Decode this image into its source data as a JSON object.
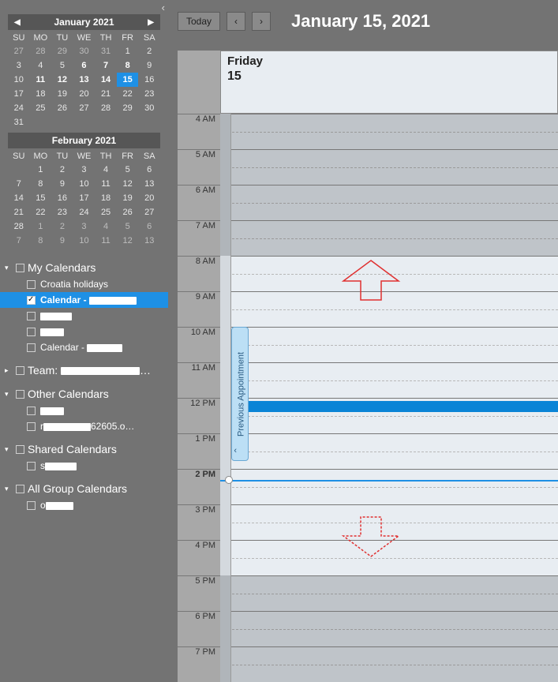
{
  "sidebar": {
    "month1": {
      "title": "January 2021",
      "dows": [
        "SU",
        "MO",
        "TU",
        "WE",
        "TH",
        "FR",
        "SA"
      ],
      "days": [
        {
          "n": "27",
          "in": false
        },
        {
          "n": "28",
          "in": false
        },
        {
          "n": "29",
          "in": false
        },
        {
          "n": "30",
          "in": false
        },
        {
          "n": "31",
          "in": false
        },
        {
          "n": "1",
          "in": true
        },
        {
          "n": "2",
          "in": true
        },
        {
          "n": "3",
          "in": true
        },
        {
          "n": "4",
          "in": true
        },
        {
          "n": "5",
          "in": true
        },
        {
          "n": "6",
          "in": true,
          "b": true
        },
        {
          "n": "7",
          "in": true,
          "b": true
        },
        {
          "n": "8",
          "in": true,
          "b": true
        },
        {
          "n": "9",
          "in": true
        },
        {
          "n": "10",
          "in": true
        },
        {
          "n": "11",
          "in": true,
          "b": true
        },
        {
          "n": "12",
          "in": true,
          "b": true
        },
        {
          "n": "13",
          "in": true,
          "b": true
        },
        {
          "n": "14",
          "in": true,
          "b": true
        },
        {
          "n": "15",
          "in": true,
          "sel": true
        },
        {
          "n": "16",
          "in": true
        },
        {
          "n": "17",
          "in": true
        },
        {
          "n": "18",
          "in": true
        },
        {
          "n": "19",
          "in": true
        },
        {
          "n": "20",
          "in": true
        },
        {
          "n": "21",
          "in": true
        },
        {
          "n": "22",
          "in": true
        },
        {
          "n": "23",
          "in": true
        },
        {
          "n": "24",
          "in": true
        },
        {
          "n": "25",
          "in": true
        },
        {
          "n": "26",
          "in": true
        },
        {
          "n": "27",
          "in": true
        },
        {
          "n": "28",
          "in": true
        },
        {
          "n": "29",
          "in": true
        },
        {
          "n": "30",
          "in": true
        },
        {
          "n": "31",
          "in": true
        },
        {
          "n": "",
          "in": false
        },
        {
          "n": "",
          "in": false
        },
        {
          "n": "",
          "in": false
        },
        {
          "n": "",
          "in": false
        },
        {
          "n": "",
          "in": false
        },
        {
          "n": "",
          "in": false
        }
      ]
    },
    "month2": {
      "title": "February 2021",
      "dows": [
        "SU",
        "MO",
        "TU",
        "WE",
        "TH",
        "FR",
        "SA"
      ],
      "days": [
        {
          "n": "",
          "in": false
        },
        {
          "n": "1",
          "in": true
        },
        {
          "n": "2",
          "in": true
        },
        {
          "n": "3",
          "in": true
        },
        {
          "n": "4",
          "in": true
        },
        {
          "n": "5",
          "in": true
        },
        {
          "n": "6",
          "in": true
        },
        {
          "n": "7",
          "in": true
        },
        {
          "n": "8",
          "in": true
        },
        {
          "n": "9",
          "in": true
        },
        {
          "n": "10",
          "in": true
        },
        {
          "n": "11",
          "in": true
        },
        {
          "n": "12",
          "in": true
        },
        {
          "n": "13",
          "in": true
        },
        {
          "n": "14",
          "in": true
        },
        {
          "n": "15",
          "in": true
        },
        {
          "n": "16",
          "in": true
        },
        {
          "n": "17",
          "in": true
        },
        {
          "n": "18",
          "in": true
        },
        {
          "n": "19",
          "in": true
        },
        {
          "n": "20",
          "in": true
        },
        {
          "n": "21",
          "in": true
        },
        {
          "n": "22",
          "in": true
        },
        {
          "n": "23",
          "in": true
        },
        {
          "n": "24",
          "in": true
        },
        {
          "n": "25",
          "in": true
        },
        {
          "n": "26",
          "in": true
        },
        {
          "n": "27",
          "in": true
        },
        {
          "n": "28",
          "in": true
        },
        {
          "n": "1",
          "in": false
        },
        {
          "n": "2",
          "in": false
        },
        {
          "n": "3",
          "in": false
        },
        {
          "n": "4",
          "in": false
        },
        {
          "n": "5",
          "in": false
        },
        {
          "n": "6",
          "in": false
        },
        {
          "n": "7",
          "in": false
        },
        {
          "n": "8",
          "in": false
        },
        {
          "n": "9",
          "in": false
        },
        {
          "n": "10",
          "in": false
        },
        {
          "n": "11",
          "in": false
        },
        {
          "n": "12",
          "in": false
        },
        {
          "n": "13",
          "in": false
        }
      ]
    },
    "groups": {
      "my": {
        "label": "My Calendars",
        "items": [
          {
            "label": "Croatia holidays",
            "checked": false
          },
          {
            "label": "Calendar - ",
            "suffix_redact": 60,
            "checked": true,
            "selected": true,
            "bold": true
          },
          {
            "label": "",
            "suffix_redact": 40,
            "checked": false
          },
          {
            "label": "",
            "suffix_redact": 30,
            "checked": false
          },
          {
            "label": "Calendar - ",
            "suffix_redact": 45,
            "checked": false
          }
        ]
      },
      "team": {
        "label": "Team: ",
        "suffix_redact": 100,
        "trail": "…"
      },
      "other": {
        "label": "Other Calendars",
        "items": [
          {
            "label": "",
            "suffix_redact": 30,
            "checked": false
          },
          {
            "label": "",
            "prefix": "r",
            "suffix_redact": 60,
            "trail": "62605.o…",
            "checked": false
          }
        ]
      },
      "shared": {
        "label": "Shared Calendars",
        "items": [
          {
            "label": "s",
            "suffix_redact": 40,
            "checked": false
          }
        ]
      },
      "allgroup": {
        "label": "All Group Calendars",
        "items": [
          {
            "label": "",
            "prefix": "o",
            "suffix_redact": 35,
            "checked": false
          }
        ]
      }
    }
  },
  "toolbar": {
    "today": "Today",
    "date_title": "January 15, 2021"
  },
  "schedule": {
    "dow": "Friday",
    "dnum": "15",
    "times": [
      "4 AM",
      "5 AM",
      "6 AM",
      "7 AM",
      "8 AM",
      "9 AM",
      "10 AM",
      "11 AM",
      "12 PM",
      "1 PM",
      "2 PM",
      "3 PM",
      "4 PM",
      "5 PM",
      "6 PM",
      "7 PM"
    ],
    "work_start_index": 4,
    "work_end_index": 13,
    "now_index": 10.3,
    "prev_appt_label": "Previous Appointment",
    "prev_appt_top_index": 6,
    "prev_appt_span": 4,
    "appt_bar_index": 8
  }
}
